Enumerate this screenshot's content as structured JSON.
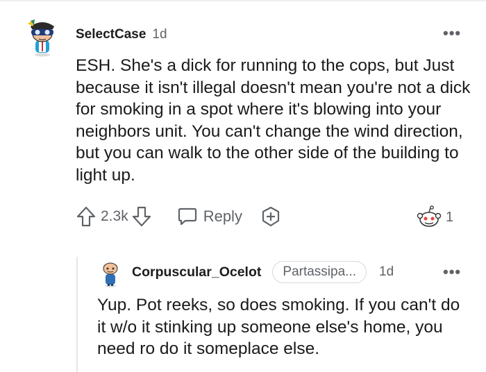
{
  "comment": {
    "author": "SelectCase",
    "time": "1d",
    "more": "•••",
    "body": "ESH. She's a dick for running to the cops, but Just because it isn't illegal doesn't mean you're not a dick for smoking in a spot where it's blowing into your neighbors unit. You can't change the wind direction, but you can walk to the other side of the building to light up.",
    "votes": "2.3k",
    "reply_label": "Reply",
    "award_count": "1",
    "icons": {
      "upvote": "arrow-up-icon",
      "downvote": "arrow-down-icon",
      "reply": "speech-bubble-icon",
      "award": "plus-circle-icon",
      "awards_received": "snoo-face-icon"
    }
  },
  "reply": {
    "author": "Corpuscular_Ocelot",
    "flair": "Partassipa...",
    "time": "1d",
    "more": "•••",
    "body": "Yup. Pot reeks, so does smoking. If you can't do it w/o it stinking up someone else's home, you need ro do it someplace else."
  },
  "colors": {
    "text": "#1a1a1b",
    "meta": "#5f6368",
    "divider": "#e6e6e6"
  }
}
